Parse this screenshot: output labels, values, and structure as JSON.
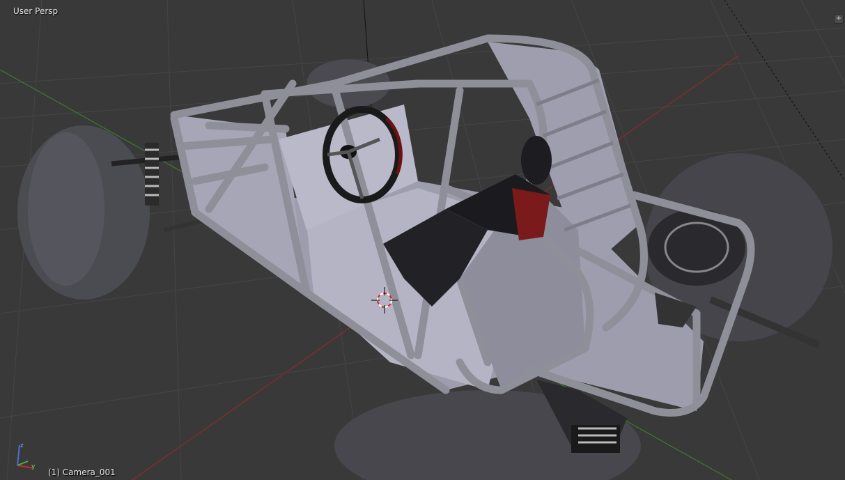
{
  "viewport": {
    "view_label": "User Persp",
    "object_label": "(1) Camera_001",
    "corner_widget_glyph": "+"
  },
  "axis_gizmo": {
    "z_label": "z",
    "y_label": "y"
  },
  "colors": {
    "background": "#393939",
    "grid": "#4a4a4a",
    "x_axis": "#8b2b2b",
    "y_axis": "#4c8b2b",
    "frame": "#8f8f9a",
    "panel": "#a9a9b8",
    "tire": "#4b4b52",
    "seat": "#222226",
    "accent_red": "#7a1a1a"
  },
  "icons": {
    "cursor": "3d-cursor-icon",
    "gizmo": "axis-gizmo-icon",
    "corner": "plus-icon"
  }
}
